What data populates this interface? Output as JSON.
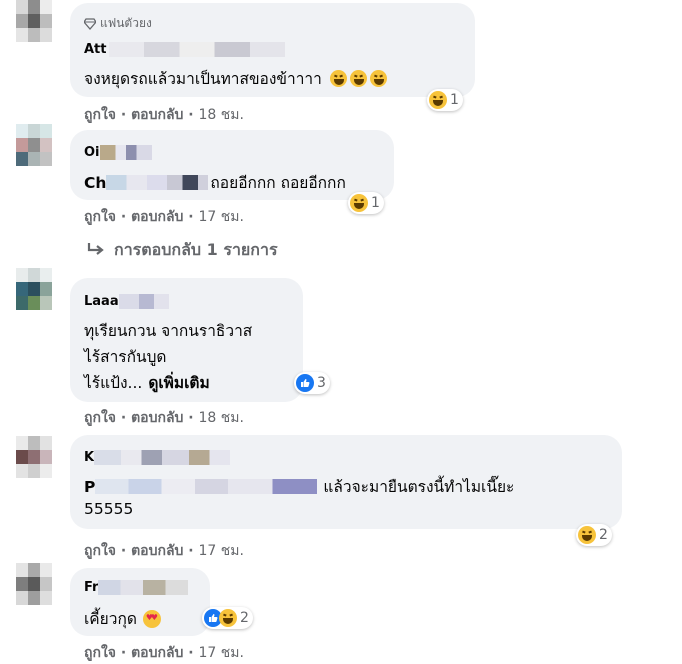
{
  "comments": [
    {
      "badge": "แฟนตัวยง",
      "name": "Att",
      "lines": [
        "จงหยุดรถแล้วมาเป็นทาสของข้าาาา"
      ],
      "reactions": [
        {
          "type": "haha"
        }
      ],
      "reaction_count": "1",
      "like_label": "ถูกใจ",
      "reply_label": "ตอบกลับ",
      "time": "18 ชม."
    },
    {
      "name": "Oi",
      "lines": [
        "Ch",
        "ถอยอีกกก ถอยอีกกก"
      ],
      "reactions": [
        {
          "type": "haha"
        }
      ],
      "reaction_count": "1",
      "like_label": "ถูกใจ",
      "reply_label": "ตอบกลับ",
      "time": "17 ชม.",
      "replies_label": "การตอบกลับ 1 รายการ"
    },
    {
      "name": "Laaa",
      "lines": [
        "ทุเรียนกวน จากนราธิวาส",
        "ไร้สารกันบูด",
        "ไร้แป้ง..."
      ],
      "see_more": "ดูเพิ่มเติม",
      "reactions": [
        {
          "type": "like"
        }
      ],
      "reaction_count": "3",
      "like_label": "ถูกใจ",
      "reply_label": "ตอบกลับ",
      "time": "18 ชม."
    },
    {
      "name": "K",
      "lines": [
        "P",
        "แล้วจะมายืนตรงนี้ทำไมเนี๊ยะ",
        "55555"
      ],
      "reactions": [
        {
          "type": "haha"
        }
      ],
      "reaction_count": "2",
      "like_label": "ถูกใจ",
      "reply_label": "ตอบกลับ",
      "time": "17 ชม."
    },
    {
      "name": "Fr",
      "lines": [
        "เคี้ยวกุด"
      ],
      "reactions": [
        {
          "type": "like"
        },
        {
          "type": "haha"
        }
      ],
      "reaction_count": "2",
      "like_label": "ถูกใจ",
      "reply_label": "ตอบกลับ",
      "time": "17 ชม."
    }
  ],
  "separator": "·"
}
